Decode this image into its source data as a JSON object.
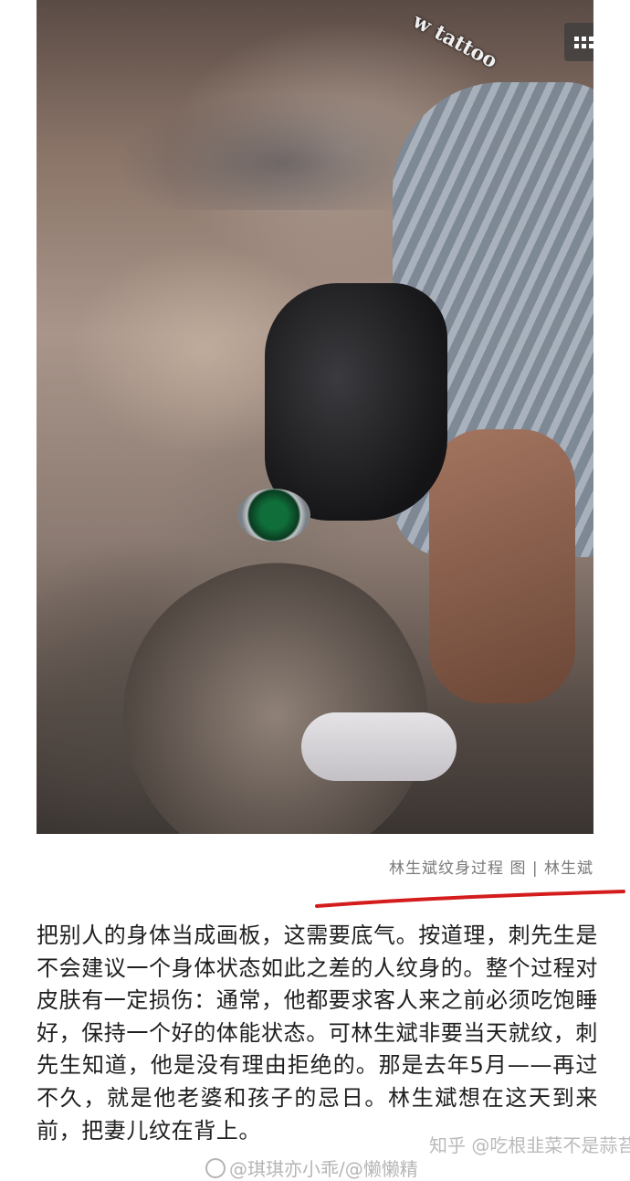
{
  "image": {
    "alt": "Tattoo artist wearing black gloves and a green-dial watch tattooing a large angel back piece",
    "overlay_text": "w tattoo"
  },
  "gallery_button": {
    "icon": "grid-icon"
  },
  "caption": "林生斌纹身过程 图 | 林生斌",
  "annotation_color": "#d41c1c",
  "article": {
    "paragraph": "把别人的身体当成画板，这需要底气。按道理，刺先生是不会建议一个身体状态如此之差的人纹身的。整个过程对皮肤有一定损伤：通常，他都要求客人来之前必须吃饱睡好，保持一个好的体能状态。可林生斌非要当天就纹，刺先生知道，他是没有理由拒绝的。那是去年5月——再过不久，就是他老婆和孩子的忌日。林生斌想在这天到来前，把妻儿纹在背上。"
  },
  "watermarks": {
    "zhihu": "知乎 @吃根韭菜不是蒜苔",
    "weibo": "@琪琪亦小乖/@懒懒精"
  }
}
